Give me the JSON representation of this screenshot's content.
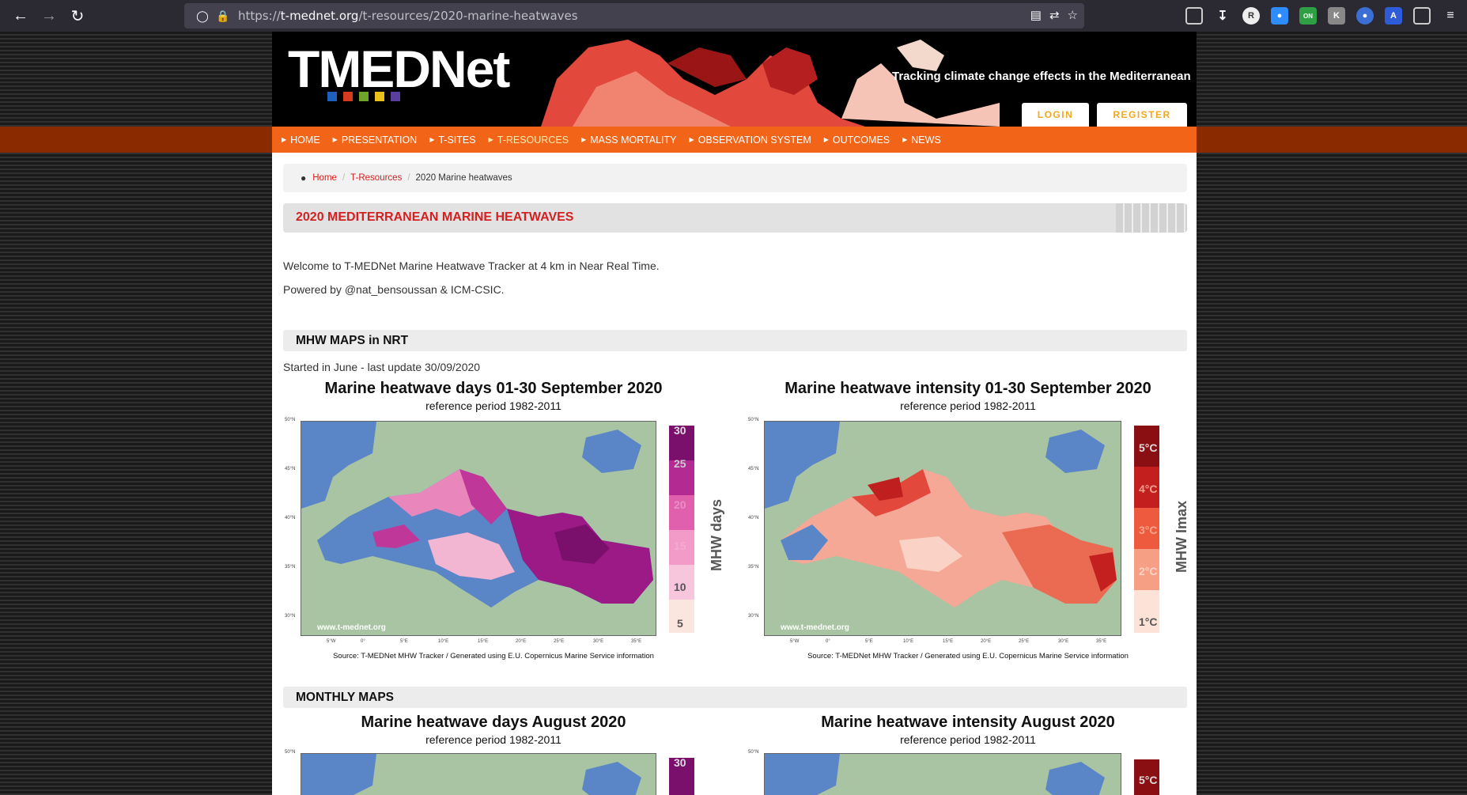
{
  "browser": {
    "url_host": "t-mednet.org",
    "url_scheme": "https://",
    "url_path": "/t-resources/2020-marine-heatwaves"
  },
  "header": {
    "logo_text": "TMEDNet",
    "tagline": "Tracking climate change effects in the Mediterranean",
    "login_label": "LOGIN",
    "register_label": "REGISTER",
    "logo_dot_colors": [
      "#1f5fbf",
      "#d63a1f",
      "#6fa52a",
      "#e8c21a",
      "#5b3fa0"
    ]
  },
  "nav": {
    "items": [
      {
        "label": "HOME",
        "active": false
      },
      {
        "label": "PRESENTATION",
        "active": false
      },
      {
        "label": "T-SITES",
        "active": false
      },
      {
        "label": "T-RESOURCES",
        "active": true
      },
      {
        "label": "MASS MORTALITY",
        "active": false
      },
      {
        "label": "OBSERVATION SYSTEM",
        "active": false
      },
      {
        "label": "OUTCOMES",
        "active": false
      },
      {
        "label": "NEWS",
        "active": false
      }
    ]
  },
  "breadcrumb": {
    "home": "Home",
    "section": "T-Resources",
    "current": "2020 Marine heatwaves"
  },
  "page": {
    "title": "2020 MEDITERRANEAN MARINE HEATWAVES",
    "intro_1": "Welcome to T-MEDNet Marine Heatwave Tracker at 4 km in Near Real Time.",
    "intro_2": "Powered by @nat_bensoussan & ICM-CSIC.",
    "section_nrt": "MHW MAPS in NRT",
    "nrt_note": "Started in June - last update 30/09/2020",
    "section_monthly": "MONTHLY MAPS"
  },
  "figures": {
    "days_sep": {
      "title": "Marine heatwave days 01-30 September 2020",
      "subtitle": "reference period 1982-2011",
      "source": "Source: T-MEDNet MHW Tracker / Generated using E.U. Copernicus Marine Service information",
      "watermark": "www.t-mednet.org",
      "colorbar_title": "MHW days",
      "colorbar_labels": [
        "30",
        "25",
        "20",
        "15",
        "10",
        "5"
      ],
      "lat_ticks": [
        "50°N",
        "45°N",
        "40°N",
        "35°N",
        "30°N"
      ],
      "lon_ticks": [
        "5°W",
        "0°",
        "5°E",
        "10°E",
        "15°E",
        "20°E",
        "25°E",
        "30°E",
        "35°E"
      ]
    },
    "intensity_sep": {
      "title": "Marine heatwave intensity 01-30 September 2020",
      "subtitle": "reference period 1982-2011",
      "source": "Source: T-MEDNet MHW Tracker / Generated using E.U. Copernicus Marine Service information",
      "watermark": "www.t-mednet.org",
      "colorbar_title": "MHW Imax",
      "colorbar_labels": [
        "5°C",
        "4°C",
        "3°C",
        "2°C",
        "1°C"
      ],
      "lat_ticks": [
        "50°N",
        "45°N",
        "40°N",
        "35°N",
        "30°N"
      ],
      "lon_ticks": [
        "5°W",
        "0°",
        "5°E",
        "10°E",
        "15°E",
        "20°E",
        "25°E",
        "30°E",
        "35°E"
      ]
    },
    "days_aug": {
      "title": "Marine heatwave days August 2020",
      "subtitle": "reference period 1982-2011",
      "colorbar_top": "30",
      "lat_top": "50°N"
    },
    "intensity_aug": {
      "title": "Marine heatwave intensity August 2020",
      "subtitle": "reference period 1982-2011",
      "colorbar_top": "5°C",
      "lat_top": "50°N"
    }
  },
  "colors": {
    "accent_orange": "#f26519",
    "title_red": "#d42020",
    "land": "#a8c4a3",
    "sea": "#5a86c8"
  }
}
